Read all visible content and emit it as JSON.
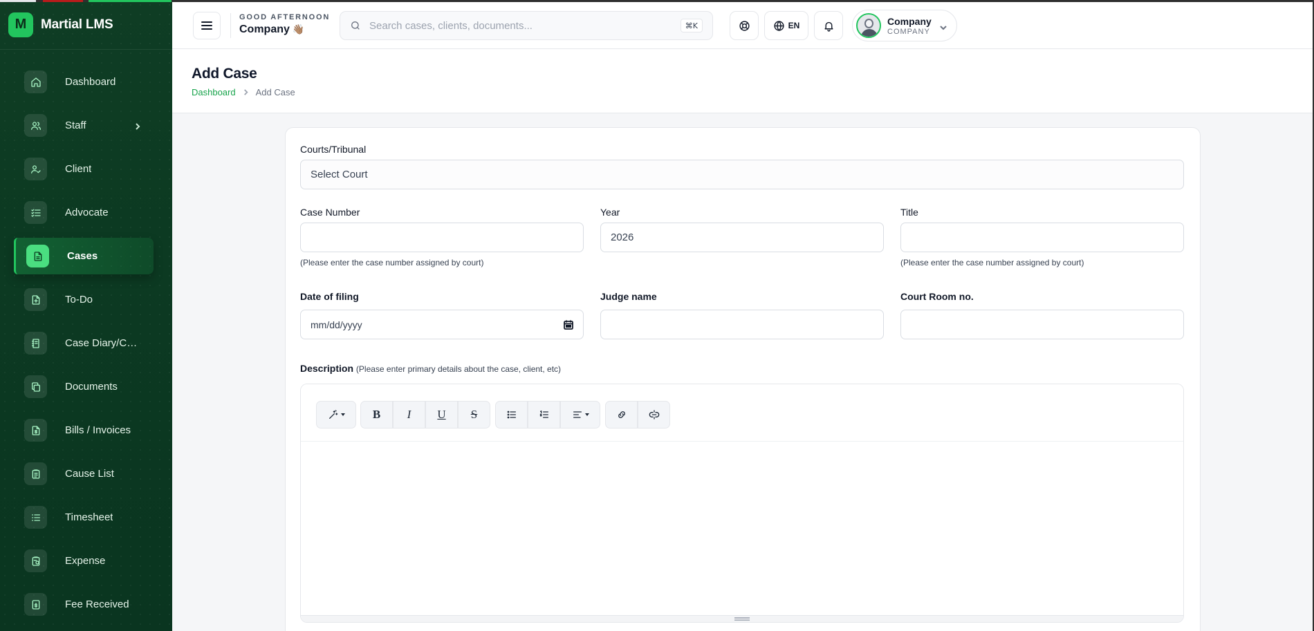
{
  "app": {
    "brand_letter": "M",
    "brand_name": "Martial LMS"
  },
  "sidebar": {
    "items": [
      {
        "label": "Dashboard",
        "icon": "home-icon"
      },
      {
        "label": "Staff",
        "icon": "users-icon",
        "has_submenu": true
      },
      {
        "label": "Client",
        "icon": "user-check-icon"
      },
      {
        "label": "Advocate",
        "icon": "list-check-icon"
      },
      {
        "label": "Cases",
        "icon": "file-text-icon",
        "active": true
      },
      {
        "label": "To-Do",
        "icon": "file-plus-icon"
      },
      {
        "label": "Case Diary/Calendar",
        "icon": "notebook-icon"
      },
      {
        "label": "Documents",
        "icon": "copy-icon"
      },
      {
        "label": "Bills / Invoices",
        "icon": "receipt-icon"
      },
      {
        "label": "Cause List",
        "icon": "clipboard-icon"
      },
      {
        "label": "Timesheet",
        "icon": "list-icon"
      },
      {
        "label": "Expense",
        "icon": "clipboard-money-icon"
      },
      {
        "label": "Fee Received",
        "icon": "money-icon"
      }
    ]
  },
  "header": {
    "greeting": "GOOD AFTERNOON",
    "greeting_name": "Company",
    "greeting_emoji": "👋🏽",
    "search_placeholder": "Search cases, clients, documents...",
    "search_shortcut": "⌘K",
    "language": "EN",
    "profile_name": "Company",
    "profile_role": "COMPANY"
  },
  "page": {
    "title": "Add Case",
    "breadcrumb": [
      "Dashboard",
      "Add Case"
    ]
  },
  "form": {
    "court": {
      "label": "Courts/Tribunal",
      "value": "Select Court"
    },
    "case_number": {
      "label": "Case Number",
      "value": "",
      "help": "(Please enter the case number assigned by court)"
    },
    "year": {
      "label": "Year",
      "value": "2026"
    },
    "title": {
      "label": "Title",
      "value": "",
      "help": "(Please enter the case number assigned by court)"
    },
    "date_of_filing": {
      "label": "Date of filing",
      "placeholder": "mm/dd/yyyy"
    },
    "judge_name": {
      "label": "Judge name",
      "value": ""
    },
    "court_room": {
      "label": "Court Room no.",
      "value": ""
    },
    "description": {
      "label": "Description",
      "hint": "(Please enter primary details about the case, client, etc)"
    },
    "toolbar": {
      "bold": "B",
      "italic": "I",
      "underline": "U",
      "strike": "S"
    }
  },
  "colors": {
    "accent": "#22c55e",
    "sidebar_bg": "#0f3d24",
    "link": "#16a34a"
  }
}
